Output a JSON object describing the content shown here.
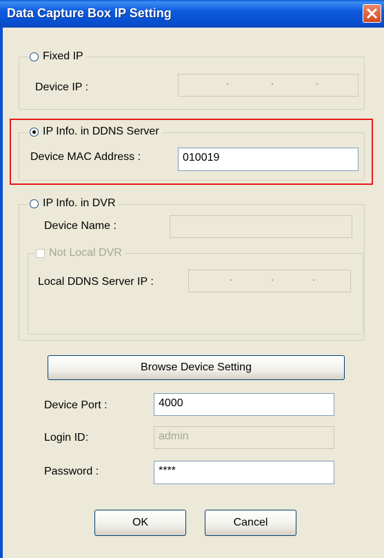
{
  "window": {
    "title": "Data Capture Box IP Setting"
  },
  "fixed_ip": {
    "label": "Fixed IP",
    "selected": false,
    "device_ip_label": "Device IP :"
  },
  "ddns": {
    "label": "IP Info. in DDNS Server",
    "selected": true,
    "mac_label": "Device MAC Address :",
    "mac_value": "010019"
  },
  "dvr": {
    "label": "IP Info. in DVR",
    "selected": false,
    "device_name_label": "Device Name :",
    "not_local_label": "Not Local DVR",
    "local_ddns_label": "Local DDNS Server IP :"
  },
  "browse_button": "Browse Device Setting",
  "port": {
    "label": "Device Port :",
    "value": "4000"
  },
  "login": {
    "label": "Login ID:",
    "value": "admin"
  },
  "password": {
    "label": "Password :",
    "value": "****"
  },
  "buttons": {
    "ok": "OK",
    "cancel": "Cancel"
  },
  "colors": {
    "titlebar": "#0750D0",
    "highlight": "#E8181F",
    "face": "#ECE9D8"
  },
  "icons": {
    "close": "close-icon"
  }
}
